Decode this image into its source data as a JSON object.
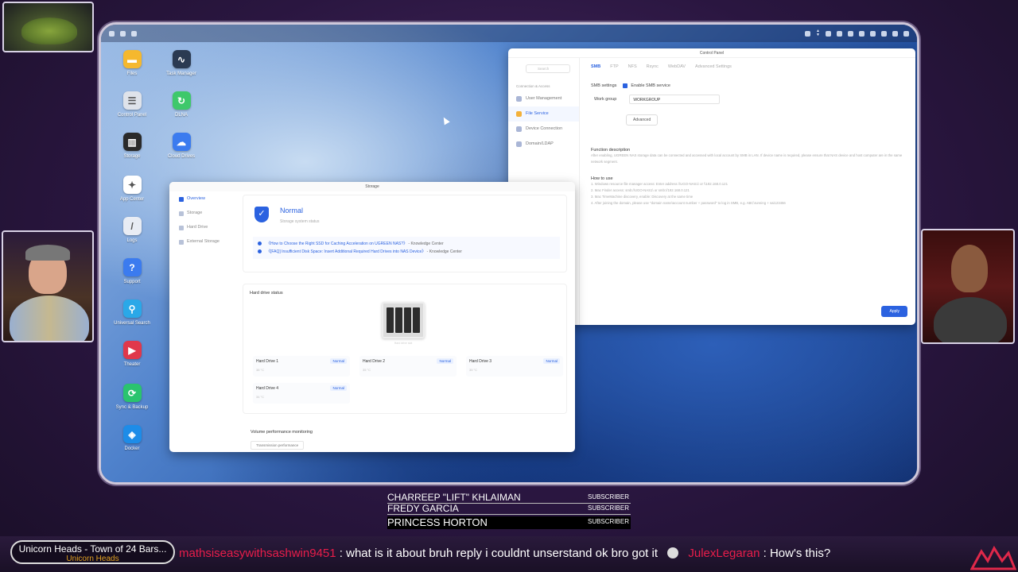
{
  "desktop": {
    "icons": [
      {
        "label": "Files",
        "icon": "folder-icon",
        "color": "#f5b82e"
      },
      {
        "label": "Task Manager",
        "icon": "task-manager-icon",
        "color": "#2b3a52"
      },
      {
        "label": "Control Panel",
        "icon": "control-panel-icon",
        "color": "#dfe3ea"
      },
      {
        "label": "DLNA",
        "icon": "dlna-icon",
        "color": "#3ec86b"
      },
      {
        "label": "Storage",
        "icon": "storage-icon",
        "color": "#2a2a2a"
      },
      {
        "label": "Cloud Drives",
        "icon": "cloud-icon",
        "color": "#3b7bef"
      },
      {
        "label": "App Center",
        "icon": "app-center-icon",
        "color": "#ffffff"
      },
      {
        "label": "Logs",
        "icon": "logs-icon",
        "color": "#e8ecf4"
      },
      {
        "label": "Support",
        "icon": "support-icon",
        "color": "#3b7bef"
      },
      {
        "label": "Universal Search",
        "icon": "search-icon",
        "color": "#2aa8e8"
      },
      {
        "label": "Theater",
        "icon": "theater-icon",
        "color": "#e0384b"
      },
      {
        "label": "Sync & Backup",
        "icon": "sync-icon",
        "color": "#2ac46e"
      },
      {
        "label": "Docker",
        "icon": "docker-icon",
        "color": "#1d8ce8"
      }
    ]
  },
  "control_panel": {
    "title": "Control Panel",
    "search_placeholder": "Search",
    "section": "Connection & Access",
    "nav": [
      "User Management",
      "File Service",
      "Device Connection",
      "Domain/LDAP"
    ],
    "tabs": [
      "SMB",
      "FTP",
      "NFS",
      "Rsync",
      "WebDAV",
      "Advanced Settings"
    ],
    "smb_settings_label": "SMB settings",
    "enable_smb": "Enable SMB service",
    "workgroup_label": "Work group",
    "workgroup_value": "WORKGROUP",
    "advanced_button": "Advanced",
    "function_title": "Function description",
    "function_text": "After enabling, UGREEN NAS storage data can be connected and accessed with local account by SMB in LAN. If device name is required, please ensure that NAS device and host computer are in the same network segment.",
    "how_title": "How to use",
    "how_steps": [
      "1. Windows resource file manager access: Enter address \\\\UGO-NAS1\\ or \\\\192.168.0.121",
      "2. Mac Finder access: smb://UGO-NAS1\\ or smb://192.168.0.121",
      "3. Mac TimeMachine discovery, enable: Discovery at the same time",
      "4. After joining the domain, please use \"domain name\\account number + password\" to log in SMB, e.g. ABC\\running + sai123456"
    ],
    "apply_button": "Apply"
  },
  "storage": {
    "title": "Storage",
    "nav": [
      "Overview",
      "Storage",
      "Hard Drive",
      "External Storage"
    ],
    "status_title": "Normal",
    "status_sub": "Storage system status",
    "link1": "《How to Choose the Right SSD for Caching Acceleration on UGREEN NAS?》",
    "link1_src": "- Knowledge Center",
    "link2": "《[FAQ] Insufficient Disk Space: Insert Additional Required Hard Drives into NAS Device》",
    "link2_src": "- Knowledge Center",
    "hd_status_title": "Hard drive status",
    "nas_caption": "Hard drive slot",
    "drives": [
      {
        "name": "Hard Drive 1",
        "status": "Normal",
        "temp": "38 °C"
      },
      {
        "name": "Hard Drive 2",
        "status": "Normal",
        "temp": "35 °C"
      },
      {
        "name": "Hard Drive 3",
        "status": "Normal",
        "temp": "35 °C"
      },
      {
        "name": "Hard Drive 4",
        "status": "Normal",
        "temp": "34 °C"
      }
    ],
    "volume_title": "Volume performance monitoring",
    "volume_select": "Transmission performance"
  },
  "overlay": {
    "subscribers": [
      {
        "name": "CHARREEP \"LIFT\" KHLAIMAN",
        "tag": "SUBSCRIBER"
      },
      {
        "name": "FREDY GARCIA",
        "tag": "SUBSCRIBER"
      },
      {
        "name": "PRINCESS HORTON",
        "tag": "SUBSCRIBER"
      }
    ],
    "now_playing_title": "Unicorn Heads - Town of 24 Bars...",
    "now_playing_artist": "Unicorn Heads",
    "chat_user1": "mathsiseasywithsashwin9451",
    "chat_msg1": "what is it about  bruh reply i couldnt unserstand  ok bro got it",
    "chat_user2": "JulexLegaran",
    "chat_msg2": "How's this?"
  }
}
